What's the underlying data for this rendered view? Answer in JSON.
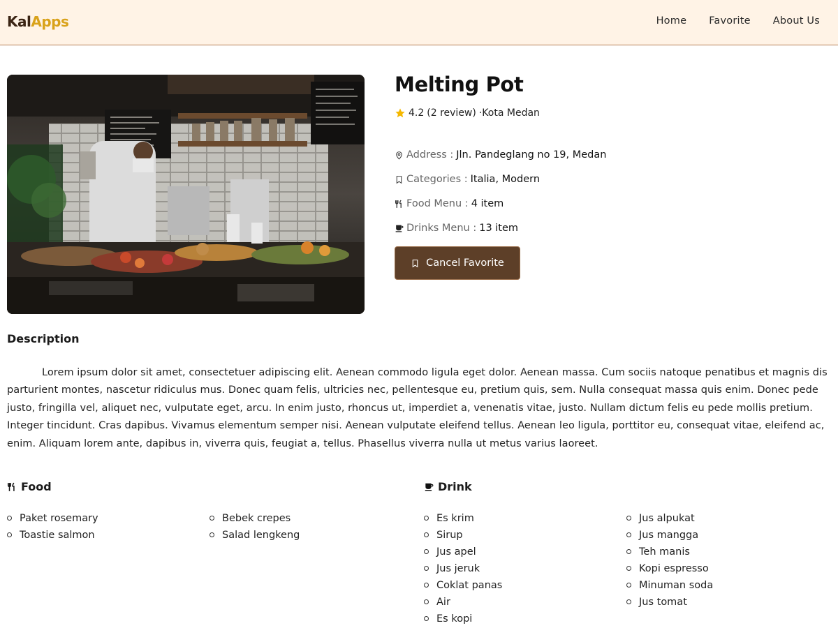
{
  "navbar": {
    "brand_part1": "Kal",
    "brand_part2": "Apps",
    "links": [
      "Home",
      "Favorite",
      "About Us"
    ]
  },
  "restaurant": {
    "name": "Melting Pot",
    "rating": "4.2",
    "reviews": "(2 review)",
    "city": "·Kota Medan",
    "address_label": "Address :",
    "address": "Jln. Pandeglang no 19, Medan",
    "categories_label": "Categories :",
    "categories": "Italia, Modern",
    "food_menu_label": "Food Menu :",
    "food_menu_count": "4 item",
    "drinks_menu_label": "Drinks Menu :",
    "drinks_menu_count": "13 item",
    "favorite_button": "Cancel Favorite"
  },
  "description": {
    "heading": "Description",
    "text": "Lorem ipsum dolor sit amet, consectetuer adipiscing elit. Aenean commodo ligula eget dolor. Aenean massa. Cum sociis natoque penatibus et magnis dis parturient montes, nascetur ridiculus mus. Donec quam felis, ultricies nec, pellentesque eu, pretium quis, sem. Nulla consequat massa quis enim. Donec pede justo, fringilla vel, aliquet nec, vulputate eget, arcu. In enim justo, rhoncus ut, imperdiet a, venenatis vitae, justo. Nullam dictum felis eu pede mollis pretium. Integer tincidunt. Cras dapibus. Vivamus elementum semper nisi. Aenean vulputate eleifend tellus. Aenean leo ligula, porttitor eu, consequat vitae, eleifend ac, enim. Aliquam lorem ante, dapibus in, viverra quis, feugiat a, tellus. Phasellus viverra nulla ut metus varius laoreet."
  },
  "food": {
    "heading": "Food",
    "col1": [
      "Paket rosemary",
      "Toastie salmon"
    ],
    "col2": [
      "Bebek crepes",
      "Salad lengkeng"
    ]
  },
  "drink": {
    "heading": "Drink",
    "col1": [
      "Es krim",
      "Sirup",
      "Jus apel",
      "Jus jeruk",
      "Coklat panas",
      "Air",
      "Es kopi"
    ],
    "col2": [
      "Jus alpukat",
      "Jus mangga",
      "Teh manis",
      "Kopi espresso",
      "Minuman soda",
      "Jus tomat"
    ]
  },
  "colors": {
    "navbar_bg": "#fff3e6",
    "brand_dark": "#3b2414",
    "brand_accent": "#d9a21b",
    "button_bg": "#5d3f28",
    "star": "#f5b800"
  }
}
